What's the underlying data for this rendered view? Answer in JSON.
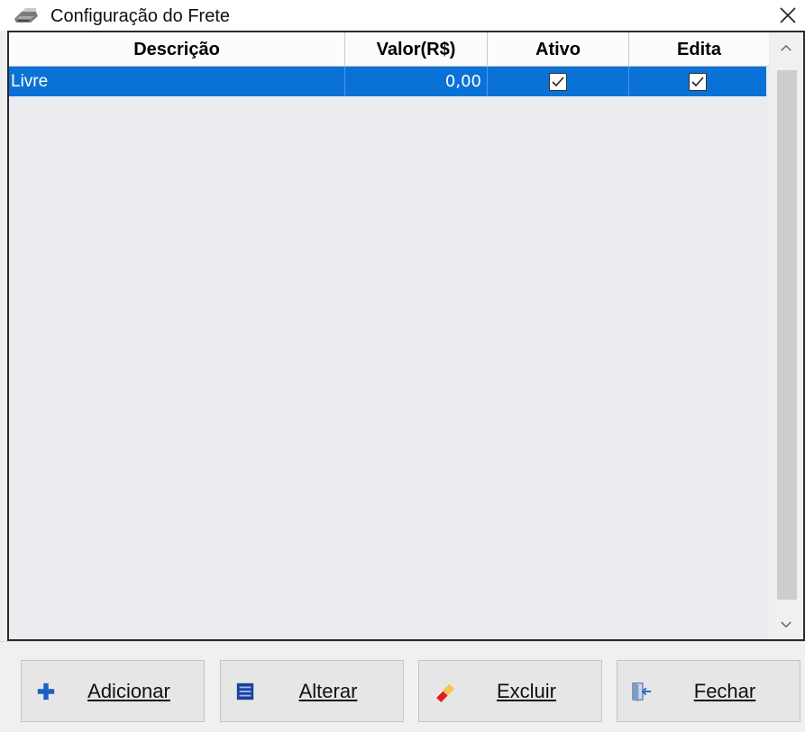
{
  "window": {
    "title": "Configuração do Frete",
    "icons": {
      "app": "printer-icon",
      "close": "close-icon"
    }
  },
  "grid": {
    "columns": [
      "Descrição",
      "Valor(R$)",
      "Ativo",
      "Edita"
    ],
    "rows": [
      {
        "descricao": "Livre",
        "valor": "0,00",
        "ativo": true,
        "edita": true,
        "selected": true
      }
    ],
    "colors": {
      "selection": "#0a71d6",
      "background": "#eaecf0"
    }
  },
  "toolbar": {
    "buttons": [
      {
        "label": "Adicionar",
        "icon": "plus-icon",
        "accent": "#1f5fc4"
      },
      {
        "label": "Alterar",
        "icon": "list-icon",
        "accent": "#1b3f9a"
      },
      {
        "label": "Excluir",
        "icon": "eraser-icon",
        "accent": "#e02020"
      },
      {
        "label": "Fechar",
        "icon": "exit-door-icon",
        "accent": "#2d6bd0"
      }
    ]
  }
}
